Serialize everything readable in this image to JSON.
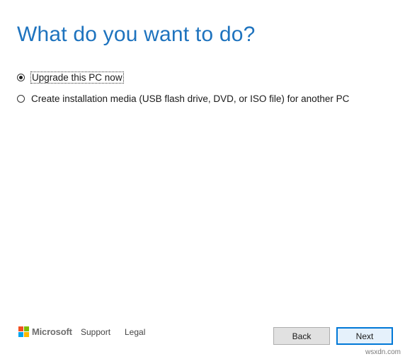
{
  "header": {
    "title": "What do you want to do?"
  },
  "options": [
    {
      "label": "Upgrade this PC now",
      "selected": true
    },
    {
      "label": "Create installation media (USB flash drive, DVD, or ISO file) for another PC",
      "selected": false
    }
  ],
  "footer": {
    "brand": "Microsoft",
    "brand_colors": [
      "#f25022",
      "#7fba00",
      "#00a4ef",
      "#ffb900"
    ],
    "links": {
      "support": "Support",
      "legal": "Legal"
    },
    "buttons": {
      "back": "Back",
      "next": "Next"
    }
  },
  "watermark": "wsxdn.com",
  "colors": {
    "title": "#1e73be",
    "next_border": "#0078d7"
  }
}
